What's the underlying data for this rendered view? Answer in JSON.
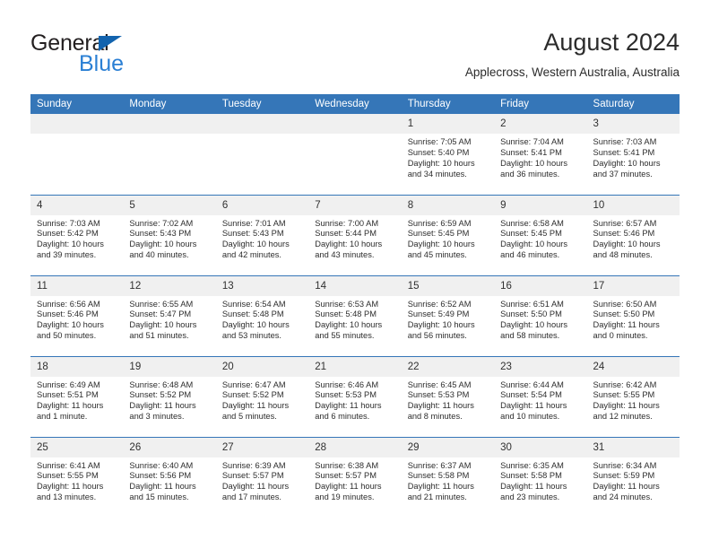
{
  "brand": {
    "name_top": "General",
    "name_bottom": "Blue",
    "accent_color": "#1263ae",
    "blue_text_color": "#2a7fd4"
  },
  "header": {
    "title": "August 2024",
    "subtitle": "Applecross, Western Australia, Australia"
  },
  "calendar": {
    "header_bg": "#3576b8",
    "daynum_bg": "#f0f0f0",
    "weekdays": [
      "Sunday",
      "Monday",
      "Tuesday",
      "Wednesday",
      "Thursday",
      "Friday",
      "Saturday"
    ],
    "weeks": [
      [
        {
          "day": "",
          "empty": true
        },
        {
          "day": "",
          "empty": true
        },
        {
          "day": "",
          "empty": true
        },
        {
          "day": "",
          "empty": true
        },
        {
          "day": "1",
          "sunrise": "Sunrise: 7:05 AM",
          "sunset": "Sunset: 5:40 PM",
          "daylight1": "Daylight: 10 hours",
          "daylight2": "and 34 minutes."
        },
        {
          "day": "2",
          "sunrise": "Sunrise: 7:04 AM",
          "sunset": "Sunset: 5:41 PM",
          "daylight1": "Daylight: 10 hours",
          "daylight2": "and 36 minutes."
        },
        {
          "day": "3",
          "sunrise": "Sunrise: 7:03 AM",
          "sunset": "Sunset: 5:41 PM",
          "daylight1": "Daylight: 10 hours",
          "daylight2": "and 37 minutes."
        }
      ],
      [
        {
          "day": "4",
          "sunrise": "Sunrise: 7:03 AM",
          "sunset": "Sunset: 5:42 PM",
          "daylight1": "Daylight: 10 hours",
          "daylight2": "and 39 minutes."
        },
        {
          "day": "5",
          "sunrise": "Sunrise: 7:02 AM",
          "sunset": "Sunset: 5:43 PM",
          "daylight1": "Daylight: 10 hours",
          "daylight2": "and 40 minutes."
        },
        {
          "day": "6",
          "sunrise": "Sunrise: 7:01 AM",
          "sunset": "Sunset: 5:43 PM",
          "daylight1": "Daylight: 10 hours",
          "daylight2": "and 42 minutes."
        },
        {
          "day": "7",
          "sunrise": "Sunrise: 7:00 AM",
          "sunset": "Sunset: 5:44 PM",
          "daylight1": "Daylight: 10 hours",
          "daylight2": "and 43 minutes."
        },
        {
          "day": "8",
          "sunrise": "Sunrise: 6:59 AM",
          "sunset": "Sunset: 5:45 PM",
          "daylight1": "Daylight: 10 hours",
          "daylight2": "and 45 minutes."
        },
        {
          "day": "9",
          "sunrise": "Sunrise: 6:58 AM",
          "sunset": "Sunset: 5:45 PM",
          "daylight1": "Daylight: 10 hours",
          "daylight2": "and 46 minutes."
        },
        {
          "day": "10",
          "sunrise": "Sunrise: 6:57 AM",
          "sunset": "Sunset: 5:46 PM",
          "daylight1": "Daylight: 10 hours",
          "daylight2": "and 48 minutes."
        }
      ],
      [
        {
          "day": "11",
          "sunrise": "Sunrise: 6:56 AM",
          "sunset": "Sunset: 5:46 PM",
          "daylight1": "Daylight: 10 hours",
          "daylight2": "and 50 minutes."
        },
        {
          "day": "12",
          "sunrise": "Sunrise: 6:55 AM",
          "sunset": "Sunset: 5:47 PM",
          "daylight1": "Daylight: 10 hours",
          "daylight2": "and 51 minutes."
        },
        {
          "day": "13",
          "sunrise": "Sunrise: 6:54 AM",
          "sunset": "Sunset: 5:48 PM",
          "daylight1": "Daylight: 10 hours",
          "daylight2": "and 53 minutes."
        },
        {
          "day": "14",
          "sunrise": "Sunrise: 6:53 AM",
          "sunset": "Sunset: 5:48 PM",
          "daylight1": "Daylight: 10 hours",
          "daylight2": "and 55 minutes."
        },
        {
          "day": "15",
          "sunrise": "Sunrise: 6:52 AM",
          "sunset": "Sunset: 5:49 PM",
          "daylight1": "Daylight: 10 hours",
          "daylight2": "and 56 minutes."
        },
        {
          "day": "16",
          "sunrise": "Sunrise: 6:51 AM",
          "sunset": "Sunset: 5:50 PM",
          "daylight1": "Daylight: 10 hours",
          "daylight2": "and 58 minutes."
        },
        {
          "day": "17",
          "sunrise": "Sunrise: 6:50 AM",
          "sunset": "Sunset: 5:50 PM",
          "daylight1": "Daylight: 11 hours",
          "daylight2": "and 0 minutes."
        }
      ],
      [
        {
          "day": "18",
          "sunrise": "Sunrise: 6:49 AM",
          "sunset": "Sunset: 5:51 PM",
          "daylight1": "Daylight: 11 hours",
          "daylight2": "and 1 minute."
        },
        {
          "day": "19",
          "sunrise": "Sunrise: 6:48 AM",
          "sunset": "Sunset: 5:52 PM",
          "daylight1": "Daylight: 11 hours",
          "daylight2": "and 3 minutes."
        },
        {
          "day": "20",
          "sunrise": "Sunrise: 6:47 AM",
          "sunset": "Sunset: 5:52 PM",
          "daylight1": "Daylight: 11 hours",
          "daylight2": "and 5 minutes."
        },
        {
          "day": "21",
          "sunrise": "Sunrise: 6:46 AM",
          "sunset": "Sunset: 5:53 PM",
          "daylight1": "Daylight: 11 hours",
          "daylight2": "and 6 minutes."
        },
        {
          "day": "22",
          "sunrise": "Sunrise: 6:45 AM",
          "sunset": "Sunset: 5:53 PM",
          "daylight1": "Daylight: 11 hours",
          "daylight2": "and 8 minutes."
        },
        {
          "day": "23",
          "sunrise": "Sunrise: 6:44 AM",
          "sunset": "Sunset: 5:54 PM",
          "daylight1": "Daylight: 11 hours",
          "daylight2": "and 10 minutes."
        },
        {
          "day": "24",
          "sunrise": "Sunrise: 6:42 AM",
          "sunset": "Sunset: 5:55 PM",
          "daylight1": "Daylight: 11 hours",
          "daylight2": "and 12 minutes."
        }
      ],
      [
        {
          "day": "25",
          "sunrise": "Sunrise: 6:41 AM",
          "sunset": "Sunset: 5:55 PM",
          "daylight1": "Daylight: 11 hours",
          "daylight2": "and 13 minutes."
        },
        {
          "day": "26",
          "sunrise": "Sunrise: 6:40 AM",
          "sunset": "Sunset: 5:56 PM",
          "daylight1": "Daylight: 11 hours",
          "daylight2": "and 15 minutes."
        },
        {
          "day": "27",
          "sunrise": "Sunrise: 6:39 AM",
          "sunset": "Sunset: 5:57 PM",
          "daylight1": "Daylight: 11 hours",
          "daylight2": "and 17 minutes."
        },
        {
          "day": "28",
          "sunrise": "Sunrise: 6:38 AM",
          "sunset": "Sunset: 5:57 PM",
          "daylight1": "Daylight: 11 hours",
          "daylight2": "and 19 minutes."
        },
        {
          "day": "29",
          "sunrise": "Sunrise: 6:37 AM",
          "sunset": "Sunset: 5:58 PM",
          "daylight1": "Daylight: 11 hours",
          "daylight2": "and 21 minutes."
        },
        {
          "day": "30",
          "sunrise": "Sunrise: 6:35 AM",
          "sunset": "Sunset: 5:58 PM",
          "daylight1": "Daylight: 11 hours",
          "daylight2": "and 23 minutes."
        },
        {
          "day": "31",
          "sunrise": "Sunrise: 6:34 AM",
          "sunset": "Sunset: 5:59 PM",
          "daylight1": "Daylight: 11 hours",
          "daylight2": "and 24 minutes."
        }
      ]
    ]
  }
}
